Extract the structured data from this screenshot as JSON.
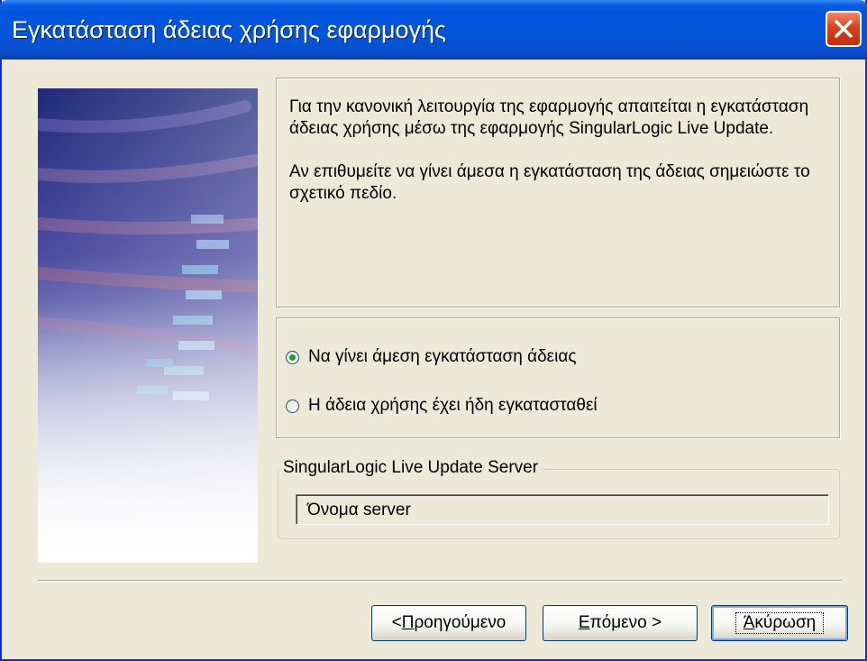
{
  "window": {
    "title": "Εγκατάσταση άδειας χρήσης εφαρμογής"
  },
  "info": {
    "paragraph1": "Για την κανονική λειτουργία της εφαρμογής απαιτείται η εγκατάσταση άδειας χρήσης μέσω της εφαρμογής SingularLogic Live Update.",
    "paragraph2": "Αν επιθυμείτε να γίνει άμεσα η εγκατάσταση της άδειας σημειώστε το σχετικό πεδίο."
  },
  "options": [
    {
      "label": "Να γίνει άμεση εγκατάσταση  άδειας",
      "checked": true
    },
    {
      "label": "Η άδεια χρήσης έχει ήδη εγκατασταθεί",
      "checked": false
    }
  ],
  "server_group": {
    "legend": "SingularLogic Live Update Server",
    "field_value": "Όνομα server"
  },
  "buttons": {
    "back_prefix": "< ",
    "back_mnemonic": "Π",
    "back_rest": "ροηγούμενο",
    "next_mnemonic": "Ε",
    "next_rest": "πόμενο >",
    "cancel_mnemonic": "Ά",
    "cancel_rest": "κύρωση"
  },
  "colors": {
    "titlebar": "#0354e0",
    "dialog_bg": "#ece9d8",
    "close_button": "#d9401e",
    "radio_dot": "#21a121"
  },
  "icons": {
    "close": "close-icon"
  }
}
